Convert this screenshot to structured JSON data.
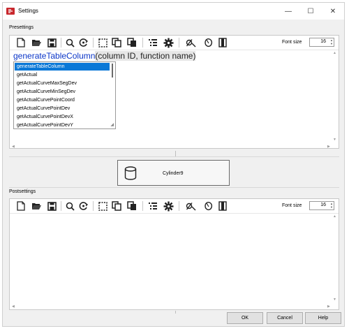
{
  "window": {
    "title": "Settings"
  },
  "presettings": {
    "label": "Presettings",
    "font_size_label": "Font size",
    "font_size_value": "16",
    "editor": {
      "function_name": "generateTableColumn",
      "signature": "(column ID, function name)"
    },
    "autocomplete": {
      "selected_index": 0,
      "items": [
        "generateTableColumn",
        "getActual",
        "getActualCurveMaxSegDev",
        "getActualCurveMinSegDev",
        "getActualCurvePointCoord",
        "getActualCurvePointDev",
        "getActualCurvePointDevX",
        "getActualCurvePointDevY"
      ]
    }
  },
  "element": {
    "name": "Cylinder9",
    "icon": "cylinder-icon"
  },
  "postsettings": {
    "label": "Postsettings",
    "font_size_label": "Font size",
    "font_size_value": "16"
  },
  "toolbar_icons": [
    "new-file-icon",
    "open-folder-icon",
    "save-icon",
    "find-icon",
    "replace-icon",
    "select-all-icon",
    "copy-icon",
    "paste-icon",
    "list-format-icon",
    "settings-icon",
    "function-icon",
    "insert-hand-icon",
    "panel-icon"
  ],
  "buttons": {
    "ok": "OK",
    "cancel": "Cancel",
    "help": "Help"
  }
}
